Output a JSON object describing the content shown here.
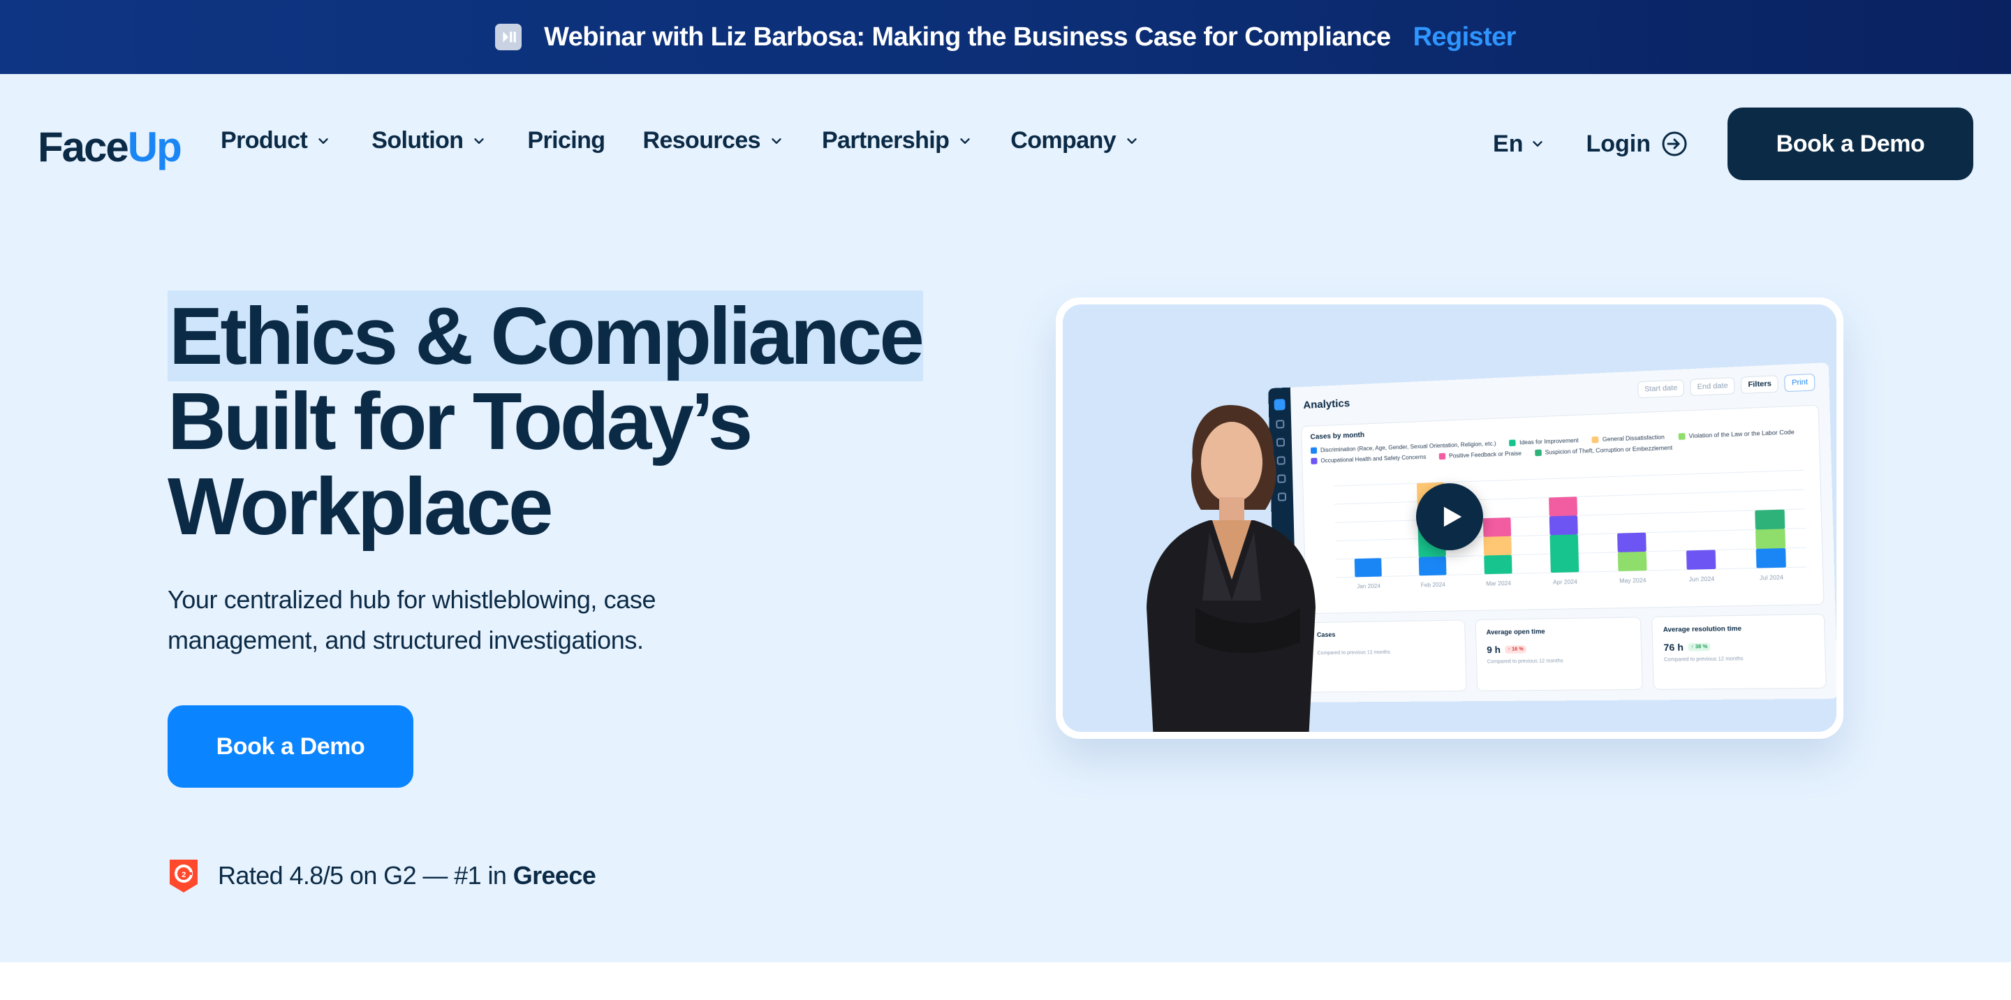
{
  "banner": {
    "text": "Webinar with Liz Barbosa: Making the Business Case for Compliance",
    "register_label": "Register"
  },
  "nav": {
    "logo_prefix": "Face",
    "logo_suffix": "Up",
    "items": [
      {
        "label": "Product",
        "has_dropdown": true
      },
      {
        "label": "Solution",
        "has_dropdown": true
      },
      {
        "label": "Pricing",
        "has_dropdown": false
      },
      {
        "label": "Resources",
        "has_dropdown": true
      },
      {
        "label": "Partnership",
        "has_dropdown": true
      },
      {
        "label": "Company",
        "has_dropdown": true
      }
    ],
    "language": "En",
    "login_label": "Login",
    "cta_label": "Book a Demo"
  },
  "hero": {
    "headline_line1": "Ethics & Compliance",
    "headline_line2": "Built for Today’s",
    "headline_line3": "Workplace",
    "subtitle_line1": "Your centralized hub for whistleblowing, case",
    "subtitle_line2": "management, and structured investigations.",
    "cta_label": "Book a Demo",
    "rating_prefix": "Rated 4.8/5 on G2 — #1 in",
    "rating_country": "Greece"
  },
  "video": {
    "dashboard_title": "Analytics",
    "controls": [
      "Start date",
      "End date",
      "Filters",
      "Print"
    ],
    "chart_title": "Cases by month",
    "legend": [
      {
        "label": "Discrimination (Race, Age, Gender, Sexual Orientation, Religion, etc.)",
        "color": "#1a86f5"
      },
      {
        "label": "Ideas for Improvement",
        "color": "#17c48d"
      },
      {
        "label": "General Dissatisfaction",
        "color": "#ffc773"
      },
      {
        "label": "Violation of the Law or the Labor Code",
        "color": "#8fdd6b"
      },
      {
        "label": "Occupational Health and Safety Concerns",
        "color": "#6c55f2"
      },
      {
        "label": "Positive Feedback or Praise",
        "color": "#f25ca0"
      },
      {
        "label": "Suspicion of Theft, Corruption or Embezzlement",
        "color": "#2fb27a"
      }
    ],
    "months": [
      "Jan 2024",
      "Feb 2024",
      "Mar 2024",
      "Apr 2024",
      "May 2024",
      "Jun 2024",
      "Jul 2024"
    ],
    "stats": [
      {
        "label": "Cases",
        "value": "",
        "badge": "",
        "note": "Compared to previous 12 months"
      },
      {
        "label": "Average open time",
        "value": "9 h",
        "badge": "↑ 16 %",
        "badge_kind": "red",
        "note": "Compared to previous 12 months"
      },
      {
        "label": "Average resolution time",
        "value": "76 h",
        "badge": "↑ 38 %",
        "badge_kind": "green",
        "note": "Compared to previous 12 months"
      }
    ]
  },
  "chart_data": {
    "type": "bar",
    "title": "Cases by month",
    "categories": [
      "Jan 2024",
      "Feb 2024",
      "Mar 2024",
      "Apr 2024",
      "May 2024",
      "Jun 2024",
      "Jul 2024"
    ],
    "stacked": true,
    "series": [
      {
        "name": "Discrimination (Race, Age, Gender, Sexual Orientation, Religion, etc.)",
        "color": "#1a86f5",
        "values": [
          1,
          1,
          0,
          0,
          0,
          0,
          1
        ]
      },
      {
        "name": "Ideas for Improvement",
        "color": "#17c48d",
        "values": [
          0,
          2,
          1,
          2,
          0,
          0,
          0
        ]
      },
      {
        "name": "General Dissatisfaction",
        "color": "#ffc773",
        "values": [
          0,
          2,
          1,
          0,
          0,
          0,
          0
        ]
      },
      {
        "name": "Violation of the Law or the Labor Code",
        "color": "#8fdd6b",
        "values": [
          0,
          0,
          0,
          0,
          1,
          0,
          1
        ]
      },
      {
        "name": "Occupational Health and Safety Concerns",
        "color": "#6c55f2",
        "values": [
          0,
          0,
          0,
          1,
          1,
          1,
          0
        ]
      },
      {
        "name": "Positive Feedback or Praise",
        "color": "#f25ca0",
        "values": [
          0,
          0,
          1,
          1,
          0,
          0,
          0
        ]
      },
      {
        "name": "Suspicion of Theft, Corruption or Embezzlement",
        "color": "#2fb27a",
        "values": [
          0,
          0,
          0,
          0,
          0,
          0,
          1
        ]
      }
    ],
    "ylim": [
      0,
      5
    ],
    "grid": true
  }
}
